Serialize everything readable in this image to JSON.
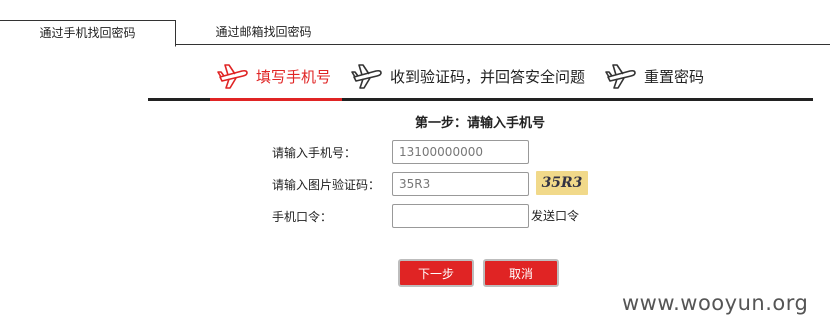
{
  "tabs": [
    {
      "label": "通过手机找回密码",
      "active": true
    },
    {
      "label": "通过邮箱找回密码",
      "active": false
    }
  ],
  "steps": [
    {
      "label": "填写手机号",
      "icon": "airplane-icon",
      "active": true
    },
    {
      "label": "收到验证码，并回答安全问题",
      "icon": "airplane-icon",
      "active": false
    },
    {
      "label": "重置密码",
      "icon": "airplane-icon",
      "active": false
    }
  ],
  "step_title": "第一步：请输入手机号",
  "form": {
    "phone_label": "请输入手机号：",
    "phone_value": "13100000000",
    "captcha_label": "请输入图片验证码：",
    "captcha_value": "35R3",
    "captcha_image_text": "35R3",
    "token_label": "手机口令：",
    "token_value": "",
    "send_code_label": "发送口令"
  },
  "buttons": {
    "next": "下一步",
    "cancel": "取消"
  },
  "watermark": "www.wooyun.org",
  "colors": {
    "accent": "#e02424",
    "captcha_bg": "#f1d98a"
  }
}
